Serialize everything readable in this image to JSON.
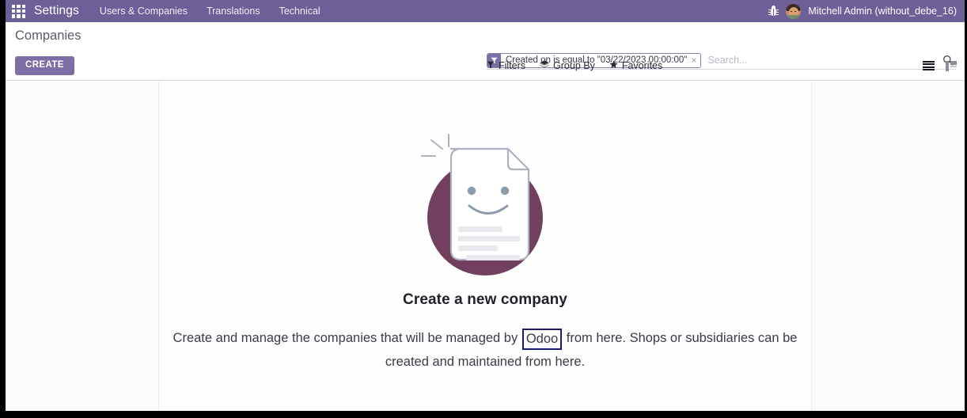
{
  "navbar": {
    "apps_icon": "apps-grid-icon",
    "brand": "Settings",
    "menu": [
      {
        "label": "Users & Companies"
      },
      {
        "label": "Translations"
      },
      {
        "label": "Technical"
      }
    ],
    "debug_icon": "bug-icon",
    "avatar_icon": "user-avatar",
    "username": "Mitchell Admin (without_debe_16)"
  },
  "control_panel": {
    "title": "Companies",
    "create_label": "CREATE",
    "search": {
      "facet_icon": "filter-funnel-icon",
      "facet_label": "Created on is equal to \"03/22/2023 00:00:00\"",
      "facet_close": "×",
      "placeholder": "Search...",
      "value": "",
      "submit_icon": "search-icon"
    },
    "menus": [
      {
        "label": "Filters",
        "icon": "filter-funnel-icon",
        "glyph": "▼"
      },
      {
        "label": "Group By",
        "icon": "layers-icon",
        "glyph": "≣"
      },
      {
        "label": "Favorites",
        "icon": "star-icon",
        "glyph": "★"
      }
    ],
    "views": [
      {
        "name": "list-view",
        "active": true
      },
      {
        "name": "kanban-view",
        "active": false
      }
    ]
  },
  "empty_state": {
    "illustration": "smiling-document-illustration",
    "heading": "Create a new company",
    "body_part1": "Create and manage the companies that will be managed by ",
    "body_highlight": "Odoo",
    "body_part2": " from here. Shops or subsidiaries can be created and maintained from here."
  },
  "colors": {
    "navbar_purple": "#6d6099",
    "primary_purple": "#7c6fa6",
    "illustration_circle": "#70405e",
    "highlight_border": "#1b1b6b",
    "text_dark": "#22212a",
    "text_muted": "#5c5a66"
  }
}
